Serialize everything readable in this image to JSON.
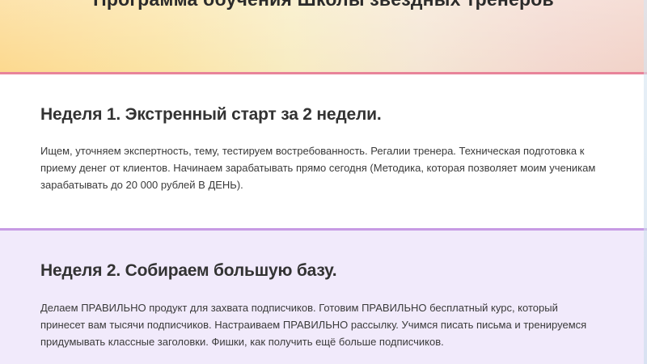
{
  "banner": {
    "title": "Программа обучения Школы звёздных тренеров"
  },
  "weeks": [
    {
      "heading": "Неделя 1. Экстренный старт за 2 недели.",
      "lines": [
        "Ищем, уточняем экспертность, тему, тестируем востребованность. Регалии тренера. Техническая подготовка к",
        "приему денег от клиентов. Начинаем зарабатывать прямо сегодня (Методика, которая позволяет моим ученикам",
        "зарабатывать до 20 000 рублей В ДЕНЬ)."
      ]
    },
    {
      "heading": "Неделя 2. Собираем большую базу.",
      "lines": [
        "Делаем ПРАВИЛЬНО продукт для захвата подписчиков. Готовим ПРАВИЛЬНО бесплатный курс, который",
        "принесет вам тысячи подписчиков. Настраиваем ПРАВИЛЬНО рассылку. Учимся писать письма и тренируемся",
        "придумывать классные заголовки. Фишки, как получить ещё больше подписчиков."
      ]
    }
  ],
  "colors": {
    "banner_rule": "#e8849a",
    "week1_rule": "#c79be4",
    "week2_background": "#f1eafb",
    "text": "#3a3a3a",
    "heading": "#333333"
  }
}
